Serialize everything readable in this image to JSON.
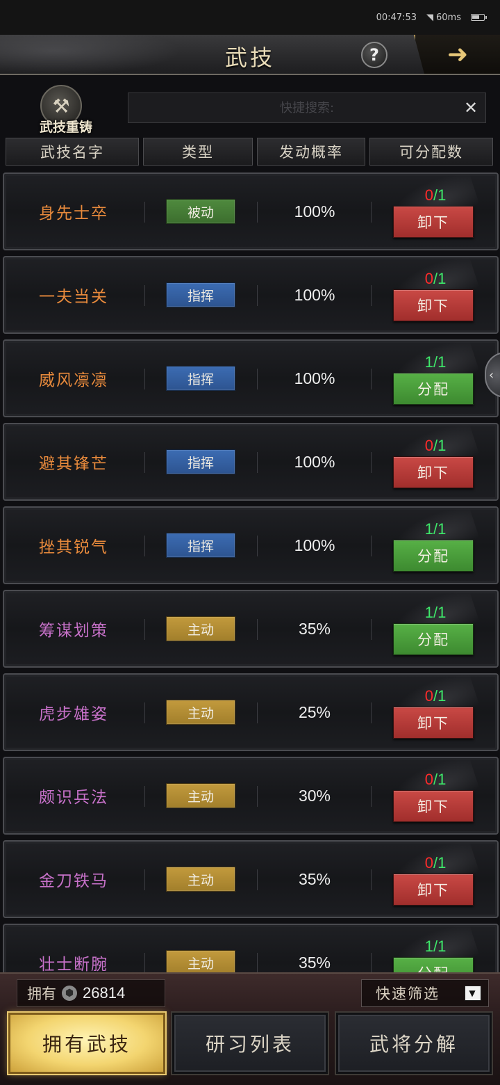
{
  "status_bar": {
    "time": "00:47:53",
    "network": "60ms"
  },
  "header": {
    "title": "武技",
    "help_label": "?",
    "back_icon": "arrow-right-icon"
  },
  "recast": {
    "label": "武技重铸"
  },
  "search": {
    "placeholder": "快捷搜索:",
    "value": "",
    "clear_label": "✕"
  },
  "columns": [
    "武技名字",
    "类型",
    "发动概率",
    "可分配数"
  ],
  "skills": [
    {
      "name": "身先士卒",
      "name_color": "orange",
      "type": "被动",
      "type_kind": "passive",
      "rate": "100%",
      "current": "0",
      "max": "1",
      "action": "卸下",
      "action_kind": "unload"
    },
    {
      "name": "一夫当关",
      "name_color": "orange",
      "type": "指挥",
      "type_kind": "command",
      "rate": "100%",
      "current": "0",
      "max": "1",
      "action": "卸下",
      "action_kind": "unload"
    },
    {
      "name": "威风凛凛",
      "name_color": "orange",
      "type": "指挥",
      "type_kind": "command",
      "rate": "100%",
      "current": "1",
      "max": "1",
      "action": "分配",
      "action_kind": "assign"
    },
    {
      "name": "避其锋芒",
      "name_color": "orange",
      "type": "指挥",
      "type_kind": "command",
      "rate": "100%",
      "current": "0",
      "max": "1",
      "action": "卸下",
      "action_kind": "unload"
    },
    {
      "name": "挫其锐气",
      "name_color": "orange",
      "type": "指挥",
      "type_kind": "command",
      "rate": "100%",
      "current": "1",
      "max": "1",
      "action": "分配",
      "action_kind": "assign"
    },
    {
      "name": "筹谋划策",
      "name_color": "purple",
      "type": "主动",
      "type_kind": "active",
      "rate": "35%",
      "current": "1",
      "max": "1",
      "action": "分配",
      "action_kind": "assign"
    },
    {
      "name": "虎步雄姿",
      "name_color": "purple",
      "type": "主动",
      "type_kind": "active",
      "rate": "25%",
      "current": "0",
      "max": "1",
      "action": "卸下",
      "action_kind": "unload"
    },
    {
      "name": "颇识兵法",
      "name_color": "purple",
      "type": "主动",
      "type_kind": "active",
      "rate": "30%",
      "current": "0",
      "max": "1",
      "action": "卸下",
      "action_kind": "unload"
    },
    {
      "name": "金刀铁马",
      "name_color": "purple",
      "type": "主动",
      "type_kind": "active",
      "rate": "35%",
      "current": "0",
      "max": "1",
      "action": "卸下",
      "action_kind": "unload"
    },
    {
      "name": "壮士断腕",
      "name_color": "purple",
      "type": "主动",
      "type_kind": "active",
      "rate": "35%",
      "current": "1",
      "max": "1",
      "action": "分配",
      "action_kind": "assign"
    }
  ],
  "colors": {
    "zero_count": "#ff2b2b",
    "one_count": "#3ee86a",
    "unload": "#b83a37",
    "assign": "#4a9d3b"
  },
  "footer": {
    "own_label": "拥有",
    "own_value": "26814",
    "filter_label": "快速筛选",
    "tabs": [
      {
        "label": "拥有武技",
        "active": true
      },
      {
        "label": "研习列表",
        "active": false
      },
      {
        "label": "武将分解",
        "active": false
      }
    ]
  }
}
